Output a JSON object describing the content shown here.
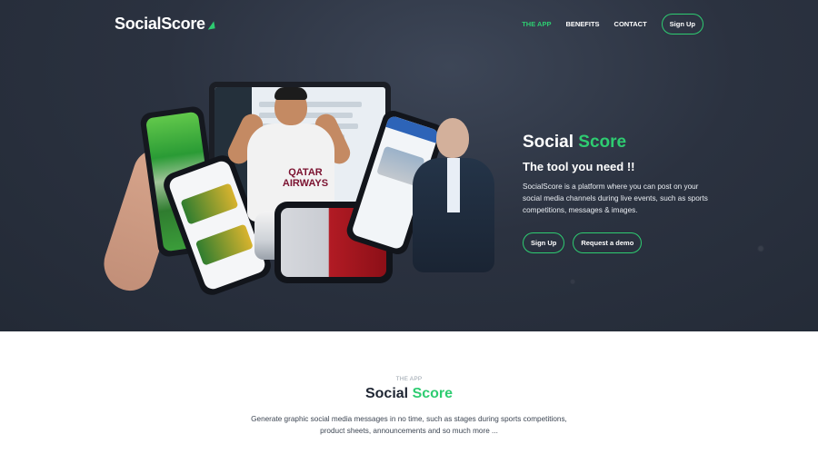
{
  "brand": {
    "logo_text": "SocialScore",
    "accent_color": "#2ecc71",
    "hero_bg": "#2b3240"
  },
  "nav": {
    "items": [
      {
        "label": "THE APP",
        "active": true
      },
      {
        "label": "BENEFITS",
        "active": false
      },
      {
        "label": "CONTACT",
        "active": false
      }
    ],
    "signup": "Sign Up"
  },
  "hero": {
    "title_part1": "Social",
    "title_part2": "Score",
    "subtitle": "The tool you need !!",
    "description": "SocialScore is a platform where you can post on your social media channels during live events, such as sports competitions, messages & images.",
    "cta_signup": "Sign Up",
    "cta_demo": "Request a demo"
  },
  "hero_media": {
    "sponsor_text": "QATAR AIRWAYS"
  },
  "section": {
    "eyebrow": "THE APP",
    "title_part1": "Social",
    "title_part2": "Score",
    "description": "Generate graphic social media messages in no time, such as stages during sports competitions, product sheets, announcements and so much more ..."
  }
}
